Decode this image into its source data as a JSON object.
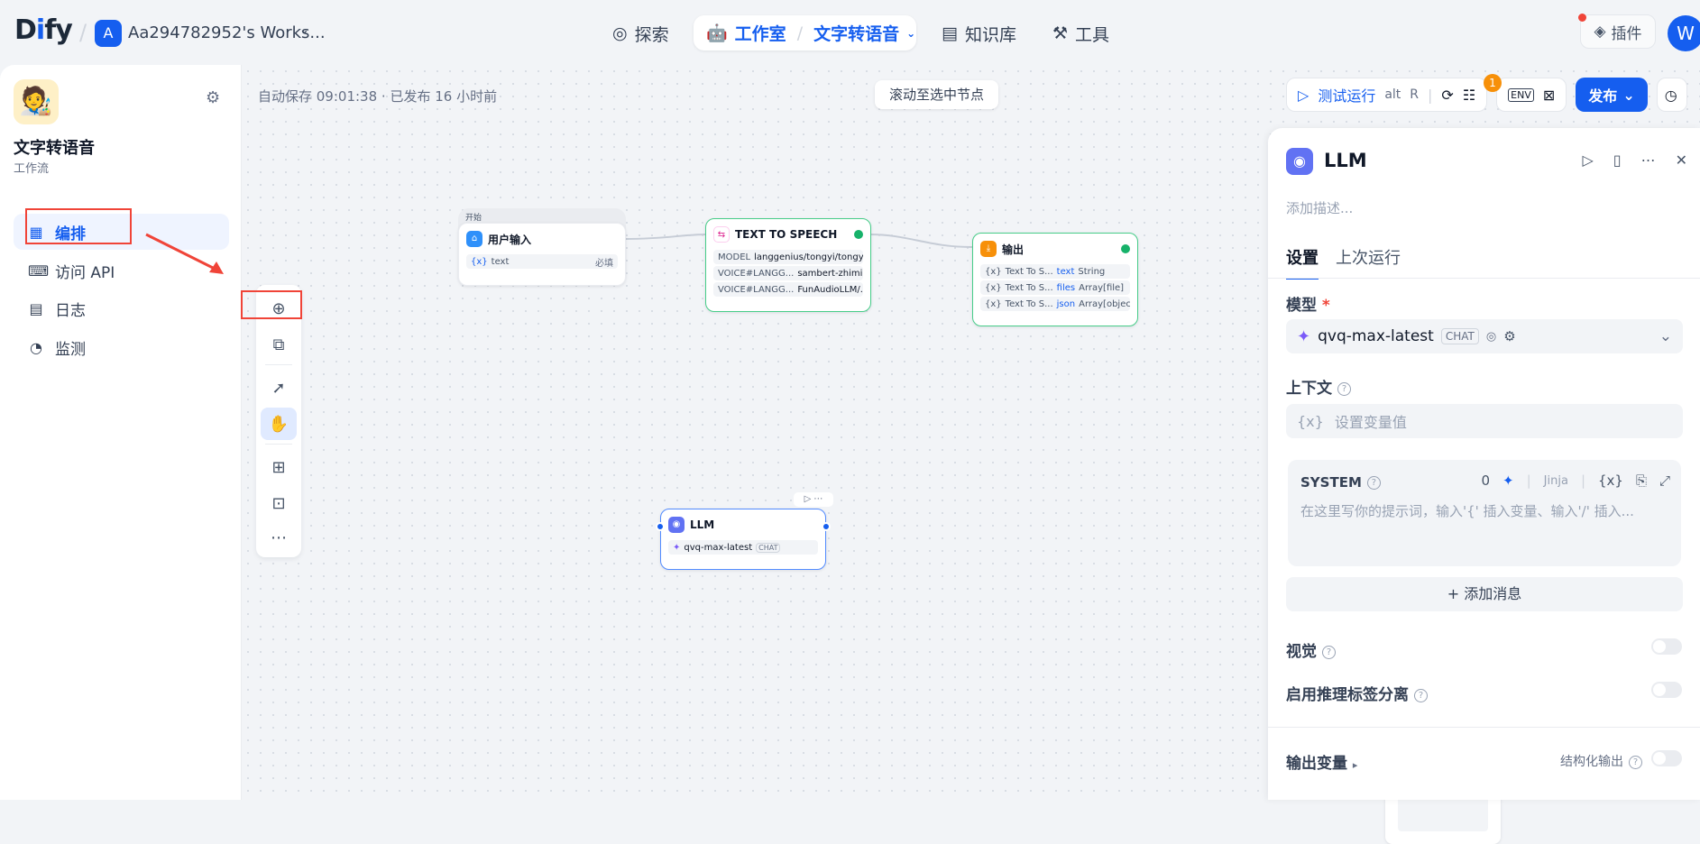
{
  "header": {
    "logo_d": "D",
    "logo_i": "i",
    "logo_fy": "fy",
    "workspace_initial": "A",
    "workspace_name": "Aa294782952's Works...",
    "nav": {
      "explore": "探索",
      "studio": "工作室",
      "current_app": "文字转语音",
      "knowledge": "知识库",
      "tools": "工具"
    },
    "plugins": "插件",
    "user_initial": "W"
  },
  "sidebar": {
    "app_title": "文字转语音",
    "app_type": "工作流",
    "items": [
      {
        "label": "编排"
      },
      {
        "label": "访问 API"
      },
      {
        "label": "日志"
      },
      {
        "label": "监测"
      }
    ]
  },
  "canvas": {
    "autosave": "自动保存 09:01:38 · 已发布 16 小时前",
    "scroll_to_selected": "滚动至选中节点",
    "run": {
      "label": "测试运行",
      "shortcut_alt": "alt",
      "shortcut_key": "R",
      "badge": "1",
      "env": "ENV"
    },
    "publish": "发布",
    "nodes": {
      "start": {
        "group": "开始",
        "title": "用户输入",
        "var": "text",
        "req": "必填"
      },
      "tts": {
        "title": "TEXT TO SPEECH",
        "rows": [
          {
            "k": "MODEL",
            "v": "langgenius/tongyi/tongyi..."
          },
          {
            "k": "VOICE#LANGG...",
            "v": "sambert-zhimin..."
          },
          {
            "k": "VOICE#LANGG...",
            "v": "FunAudioLLM/..."
          }
        ]
      },
      "output": {
        "title": "输出",
        "rows": [
          {
            "src": "Text To S...",
            "var": "text",
            "type": "String"
          },
          {
            "src": "Text To S...",
            "var": "files",
            "type": "Array[file]"
          },
          {
            "src": "Text To S...",
            "var": "json",
            "type": "Array[object]"
          }
        ]
      },
      "llm": {
        "title": "LLM",
        "model": "qvq-max-latest",
        "chip": "CHAT"
      }
    }
  },
  "panel": {
    "title": "LLM",
    "desc_placeholder": "添加描述...",
    "tabs": [
      "设置",
      "上次运行"
    ],
    "model_label": "模型",
    "model_name": "qvq-max-latest",
    "model_chip": "CHAT",
    "context_label": "上下文",
    "context_placeholder": "设置变量值",
    "system_label": "SYSTEM",
    "system_count": "0",
    "jinja": "Jinja",
    "system_placeholder": "在这里写你的提示词，输入'{' 插入变量、输入'/' 插入...",
    "add_message": "+ 添加消息",
    "vision": "视觉",
    "reasoning": "启用推理标签分离",
    "output_vars": "输出变量",
    "structured_output": "结构化输出"
  }
}
